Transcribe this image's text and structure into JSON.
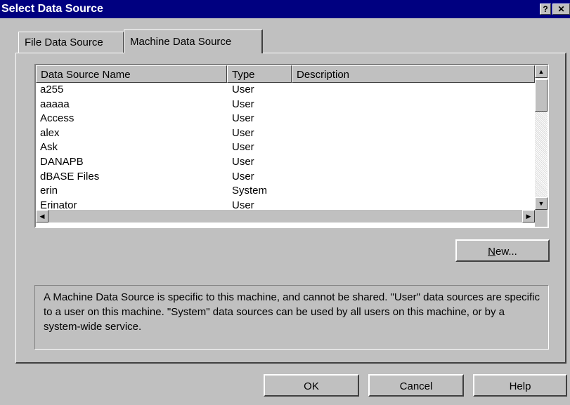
{
  "window": {
    "title": "Select Data Source",
    "help_glyph": "?",
    "close_glyph": "✕"
  },
  "tabs": [
    {
      "label": "File Data Source",
      "active": false
    },
    {
      "label": "Machine Data Source",
      "active": true
    }
  ],
  "list": {
    "columns": [
      "Data Source Name",
      "Type",
      "Description"
    ],
    "rows": [
      {
        "name": "a255",
        "type": "User",
        "description": ""
      },
      {
        "name": "aaaaa",
        "type": "User",
        "description": ""
      },
      {
        "name": "Access",
        "type": "User",
        "description": ""
      },
      {
        "name": "alex",
        "type": "User",
        "description": ""
      },
      {
        "name": "Ask",
        "type": "User",
        "description": ""
      },
      {
        "name": "DANAPB",
        "type": "User",
        "description": ""
      },
      {
        "name": "dBASE Files",
        "type": "User",
        "description": ""
      },
      {
        "name": "erin",
        "type": "System",
        "description": ""
      },
      {
        "name": "Erinator",
        "type": "User",
        "description": ""
      }
    ]
  },
  "buttons": {
    "new_first": "N",
    "new_rest": "ew...",
    "ok": "OK",
    "cancel": "Cancel",
    "help": "Help"
  },
  "info_text": "A Machine Data Source is specific to this machine, and cannot be shared.  \"User\" data sources are specific to a user on this machine.  \"System\" data sources can be used by all users on this machine, or by a system-wide service.",
  "colors": {
    "face": "#c0c0c0",
    "titlebar": "#000080",
    "list_bg": "#ffffff"
  }
}
